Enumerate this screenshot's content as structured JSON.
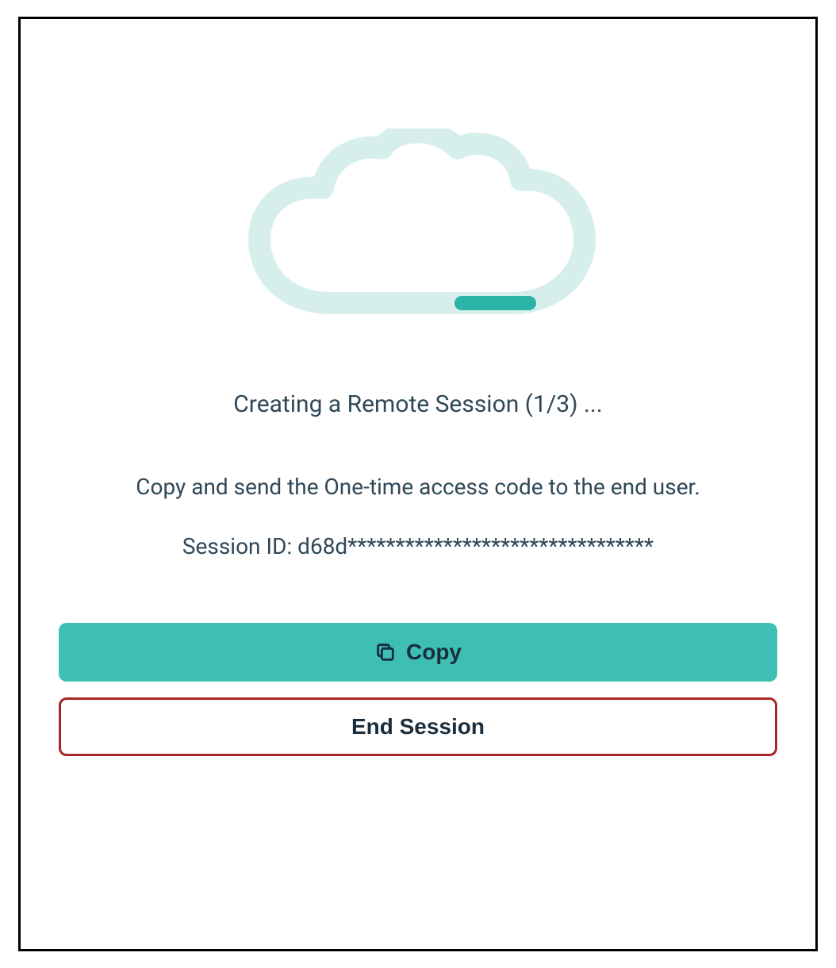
{
  "status": "Creating a Remote Session (1/3) ...",
  "instruction": "Copy and send the One-time access code to the end user.",
  "session_id_label": "Session ID: d68d********************************",
  "buttons": {
    "copy_label": "Copy",
    "end_session_label": "End Session"
  },
  "colors": {
    "accent": "#3dbfb3",
    "danger_border": "#a82828",
    "text": "#2f4858",
    "cloud_outline": "#d7efec"
  }
}
